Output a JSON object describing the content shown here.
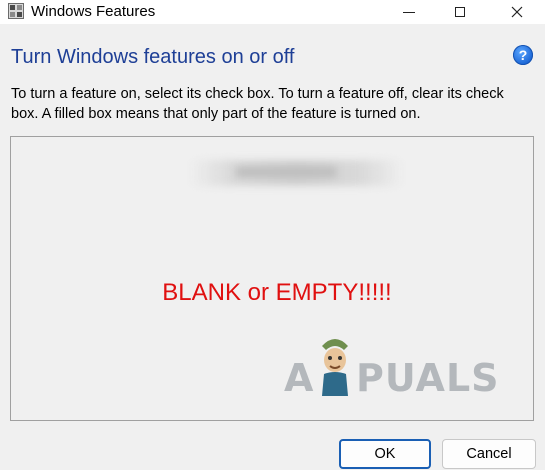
{
  "window": {
    "title": "Windows Features",
    "icon": "windows-features-icon"
  },
  "caption_buttons": {
    "minimize_icon": "minimize-icon",
    "maximize_icon": "maximize-icon",
    "close_icon": "close-icon"
  },
  "header": {
    "heading": "Turn Windows features on or off",
    "help_glyph": "?",
    "description": "To turn a feature on, select its check box. To turn a feature off, clear its check box. A filled box means that only part of the feature is turned on."
  },
  "features_panel": {
    "overlay_text": "BLANK or EMPTY!!!!!",
    "overlay_color": "#e01010"
  },
  "watermark": {
    "first_letter": "A",
    "rest": "PUALS"
  },
  "buttons": {
    "ok_label": "OK",
    "cancel_label": "Cancel"
  },
  "colors": {
    "heading": "#1e3f96",
    "accent_border": "#1a5fb4"
  }
}
